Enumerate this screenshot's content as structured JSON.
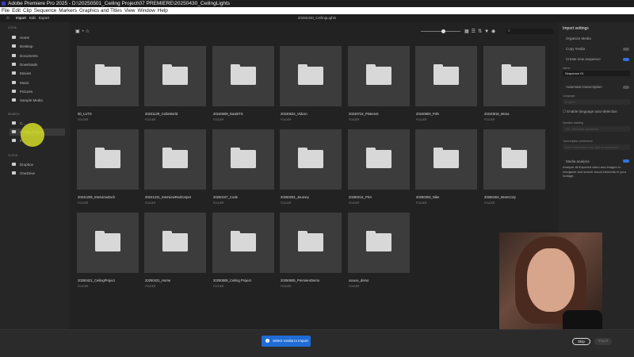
{
  "window": {
    "title": "Adobe Premiere Pro 2025 - D:\\20250501_Ceiling Project\\07 PREMIERE\\20250430_CeilingLights"
  },
  "menu": [
    "File",
    "Edit",
    "Clip",
    "Sequence",
    "Markers",
    "Graphics and Titles",
    "View",
    "Window",
    "Help"
  ],
  "appbar": {
    "tabs": [
      "Import",
      "Edit",
      "Export"
    ],
    "active": "Import",
    "project": "20250430_CeilingLights"
  },
  "sidebar": {
    "local_label": "LOCAL",
    "local": [
      "Home",
      "Desktop",
      "Documents",
      "Downloads",
      "Movies",
      "Music",
      "Pictures",
      "Sample Media"
    ],
    "search_label": "SEARCH",
    "search": [
      "C...",
      "Ceiling Project",
      "F..."
    ],
    "cloud_label": "CLOUD",
    "cloud": [
      "Dropbox",
      "OneDrive"
    ]
  },
  "search": {
    "placeholder": ""
  },
  "folders": [
    {
      "name": "00_LUTS",
      "type": "FOLDER"
    },
    {
      "name": "20231129_CelloWorld",
      "type": "FOLDER"
    },
    {
      "name": "20240609_DaviBTS",
      "type": "FOLDER"
    },
    {
      "name": "20240622_Vidcon",
      "type": "FOLDER"
    },
    {
      "name": "20240724_Pinterest",
      "type": "FOLDER"
    },
    {
      "name": "20240903_Fish",
      "type": "FOLDER"
    },
    {
      "name": "20240916_Mona",
      "type": "FOLDER"
    },
    {
      "name": "20241208_InterviewZach",
      "type": "FOLDER"
    },
    {
      "name": "20241231_InterviewRedCarpet",
      "type": "FOLDER"
    },
    {
      "name": "20250107_Code",
      "type": "FOLDER"
    },
    {
      "name": "20250202_Journey",
      "type": "FOLDER"
    },
    {
      "name": "20250214_PSA",
      "type": "FOLDER"
    },
    {
      "name": "20250303_Nike",
      "type": "FOLDER"
    },
    {
      "name": "20250404_MomCozy",
      "type": "FOLDER"
    },
    {
      "name": "20250421_CeilingProject",
      "type": "FOLDER"
    },
    {
      "name": "20250421_Home",
      "type": "FOLDER"
    },
    {
      "name": "20250508_Ceiling Project",
      "type": "FOLDER"
    },
    {
      "name": "20250605_PremiereDemo",
      "type": "FOLDER"
    },
    {
      "name": "xxxxxx_demo",
      "type": "FOLDER"
    }
  ],
  "import_settings": {
    "title": "Import settings",
    "organize": "Organize Media",
    "copy": "Copy media",
    "create_seq": "Create new sequence",
    "name_label": "Name",
    "name_value": "Sequence 01",
    "auto_trans": "Automatic transcription",
    "language_label": "Language",
    "language_value": "English",
    "auto_detect": "Enable language auto-detection",
    "speaker_label": "Speaker labeling",
    "speaker_value": "Yes, separate speakers",
    "pref_label": "Transcription preference",
    "pref_value": "Auto-transcribe only clips in sequence",
    "media_analysis": "Media analysis",
    "media_desc": "Analyze all imported video and images to recognize and search visual elements in your footage.",
    "toggles": {
      "copy": false,
      "create_seq": true,
      "auto_trans": false,
      "media_analysis": true
    }
  },
  "bottom": {
    "toast": "Select media to import",
    "skip": "Skip",
    "import": "Import"
  }
}
